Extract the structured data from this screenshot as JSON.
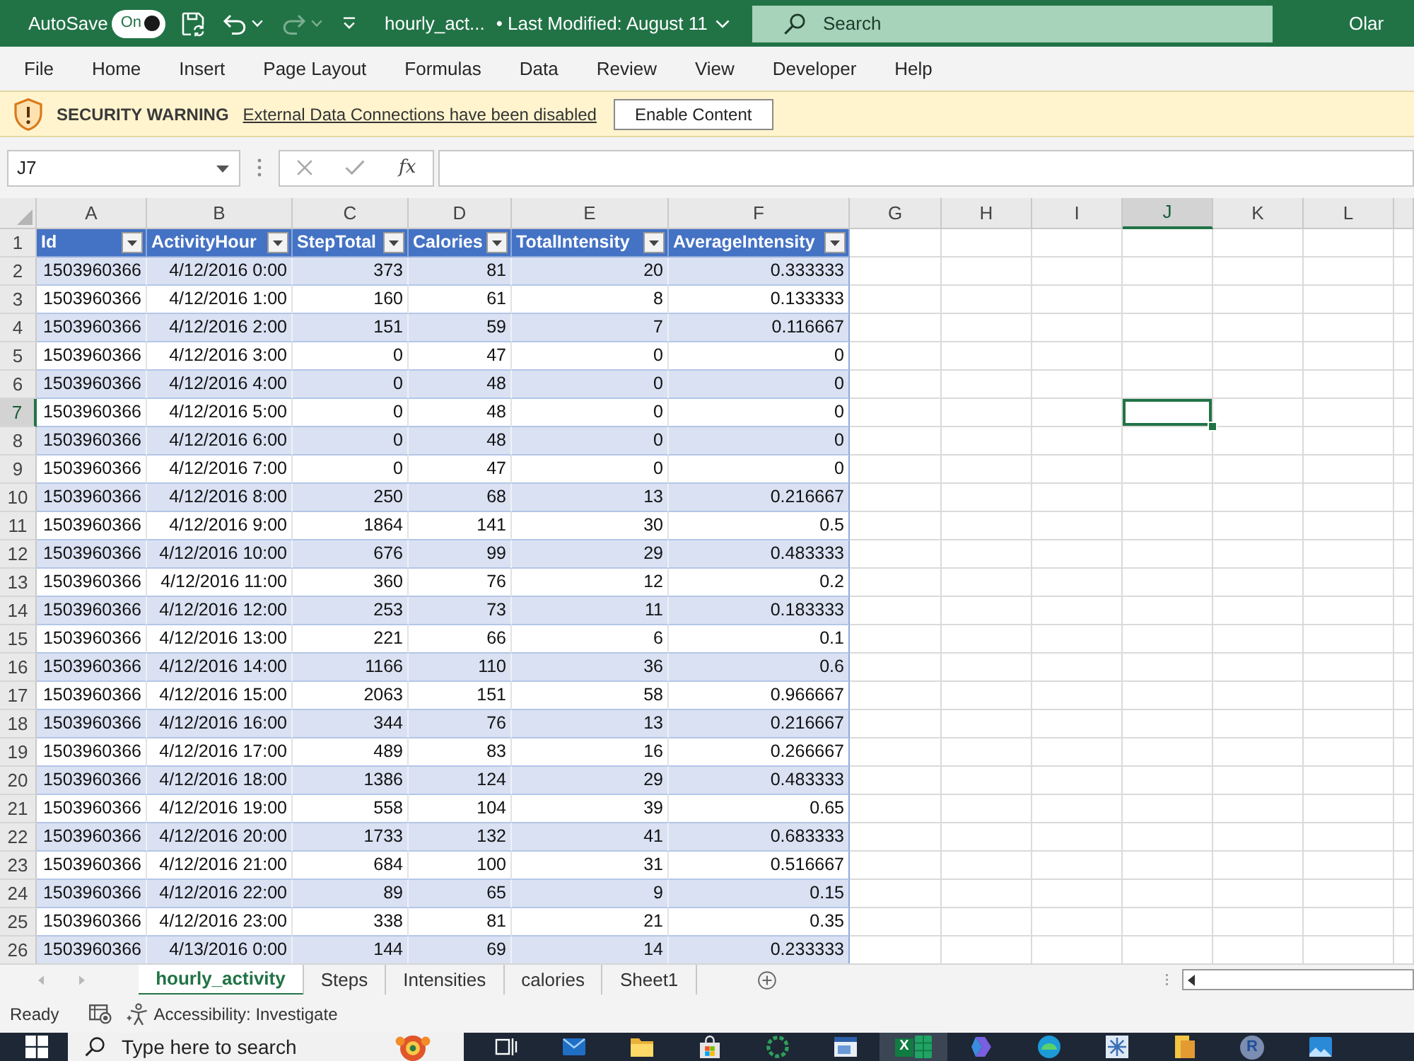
{
  "title_bar": {
    "autosave": {
      "label": "AutoSave",
      "toggle_label": "On",
      "on": true
    },
    "quick_access": [
      {
        "kind": "save",
        "disabled": false
      },
      {
        "kind": "undo",
        "disabled": false
      },
      {
        "kind": "redo",
        "disabled": true
      },
      {
        "kind": "customize",
        "disabled": false
      }
    ],
    "document": "hourly_act...",
    "modified": "• Last Modified: August 11",
    "search": {
      "placeholder": "Search"
    },
    "user": "Olar"
  },
  "menu": [
    "File",
    "Home",
    "Insert",
    "Page Layout",
    "Formulas",
    "Data",
    "Review",
    "View",
    "Developer",
    "Help"
  ],
  "security_bar": {
    "title": "SECURITY WARNING",
    "message": "External Data Connections have been disabled",
    "button": "Enable Content"
  },
  "formula_bar": {
    "name_box": "J7",
    "buttons": [
      {
        "kind": "cancel",
        "disabled": true
      },
      {
        "kind": "enter",
        "disabled": true
      }
    ],
    "function_label": "fx"
  },
  "grid": {
    "columns": [
      {
        "label": "A",
        "selected": false
      },
      {
        "label": "B",
        "selected": false
      },
      {
        "label": "C",
        "selected": false
      },
      {
        "label": "D",
        "selected": false
      },
      {
        "label": "E",
        "selected": false
      },
      {
        "label": "F",
        "selected": false
      },
      {
        "label": "G",
        "selected": false
      },
      {
        "label": "H",
        "selected": false
      },
      {
        "label": "I",
        "selected": false
      },
      {
        "label": "J",
        "selected": true
      },
      {
        "label": "K",
        "selected": false
      },
      {
        "label": "L",
        "selected": false
      }
    ],
    "table_header": {
      "row": "1",
      "autofilter": true,
      "cells": [
        "Id",
        "ActivityHour",
        "StepTotal",
        "Calories",
        "TotalIntensity",
        "AverageIntensity"
      ]
    },
    "rows": [
      {
        "row": "2",
        "selected": false,
        "cells": [
          "1503960366",
          "4/12/2016 0:00",
          "373",
          "81",
          "20",
          "0.333333"
        ]
      },
      {
        "row": "3",
        "selected": false,
        "cells": [
          "1503960366",
          "4/12/2016 1:00",
          "160",
          "61",
          "8",
          "0.133333"
        ]
      },
      {
        "row": "4",
        "selected": false,
        "cells": [
          "1503960366",
          "4/12/2016 2:00",
          "151",
          "59",
          "7",
          "0.116667"
        ]
      },
      {
        "row": "5",
        "selected": false,
        "cells": [
          "1503960366",
          "4/12/2016 3:00",
          "0",
          "47",
          "0",
          "0"
        ]
      },
      {
        "row": "6",
        "selected": false,
        "cells": [
          "1503960366",
          "4/12/2016 4:00",
          "0",
          "48",
          "0",
          "0"
        ]
      },
      {
        "row": "7",
        "selected": true,
        "cells": [
          "1503960366",
          "4/12/2016 5:00",
          "0",
          "48",
          "0",
          "0"
        ]
      },
      {
        "row": "8",
        "selected": false,
        "cells": [
          "1503960366",
          "4/12/2016 6:00",
          "0",
          "48",
          "0",
          "0"
        ]
      },
      {
        "row": "9",
        "selected": false,
        "cells": [
          "1503960366",
          "4/12/2016 7:00",
          "0",
          "47",
          "0",
          "0"
        ]
      },
      {
        "row": "10",
        "selected": false,
        "cells": [
          "1503960366",
          "4/12/2016 8:00",
          "250",
          "68",
          "13",
          "0.216667"
        ]
      },
      {
        "row": "11",
        "selected": false,
        "cells": [
          "1503960366",
          "4/12/2016 9:00",
          "1864",
          "141",
          "30",
          "0.5"
        ]
      },
      {
        "row": "12",
        "selected": false,
        "cells": [
          "1503960366",
          "4/12/2016 10:00",
          "676",
          "99",
          "29",
          "0.483333"
        ]
      },
      {
        "row": "13",
        "selected": false,
        "cells": [
          "1503960366",
          "4/12/2016 11:00",
          "360",
          "76",
          "12",
          "0.2"
        ]
      },
      {
        "row": "14",
        "selected": false,
        "cells": [
          "1503960366",
          "4/12/2016 12:00",
          "253",
          "73",
          "11",
          "0.183333"
        ]
      },
      {
        "row": "15",
        "selected": false,
        "cells": [
          "1503960366",
          "4/12/2016 13:00",
          "221",
          "66",
          "6",
          "0.1"
        ]
      },
      {
        "row": "16",
        "selected": false,
        "cells": [
          "1503960366",
          "4/12/2016 14:00",
          "1166",
          "110",
          "36",
          "0.6"
        ]
      },
      {
        "row": "17",
        "selected": false,
        "cells": [
          "1503960366",
          "4/12/2016 15:00",
          "2063",
          "151",
          "58",
          "0.966667"
        ]
      },
      {
        "row": "18",
        "selected": false,
        "cells": [
          "1503960366",
          "4/12/2016 16:00",
          "344",
          "76",
          "13",
          "0.216667"
        ]
      },
      {
        "row": "19",
        "selected": false,
        "cells": [
          "1503960366",
          "4/12/2016 17:00",
          "489",
          "83",
          "16",
          "0.266667"
        ]
      },
      {
        "row": "20",
        "selected": false,
        "cells": [
          "1503960366",
          "4/12/2016 18:00",
          "1386",
          "124",
          "29",
          "0.483333"
        ]
      },
      {
        "row": "21",
        "selected": false,
        "cells": [
          "1503960366",
          "4/12/2016 19:00",
          "558",
          "104",
          "39",
          "0.65"
        ]
      },
      {
        "row": "22",
        "selected": false,
        "cells": [
          "1503960366",
          "4/12/2016 20:00",
          "1733",
          "132",
          "41",
          "0.683333"
        ]
      },
      {
        "row": "23",
        "selected": false,
        "cells": [
          "1503960366",
          "4/12/2016 21:00",
          "684",
          "100",
          "31",
          "0.516667"
        ]
      },
      {
        "row": "24",
        "selected": false,
        "cells": [
          "1503960366",
          "4/12/2016 22:00",
          "89",
          "65",
          "9",
          "0.15"
        ]
      },
      {
        "row": "25",
        "selected": false,
        "cells": [
          "1503960366",
          "4/12/2016 23:00",
          "338",
          "81",
          "21",
          "0.35"
        ]
      },
      {
        "row": "26",
        "selected": false,
        "cells": [
          "1503960366",
          "4/13/2016 0:00",
          "144",
          "69",
          "14",
          "0.233333"
        ]
      }
    ]
  },
  "sheet_nav": [
    {
      "kind": "previous",
      "disabled": true
    },
    {
      "kind": "next",
      "disabled": true
    }
  ],
  "sheet_tabs": [
    {
      "label": "hourly_activity",
      "selected": true
    },
    {
      "label": "Steps",
      "selected": false
    },
    {
      "label": "Intensities",
      "selected": false
    },
    {
      "label": "calories",
      "selected": false
    },
    {
      "label": "Sheet1",
      "selected": false
    }
  ],
  "status_bar": {
    "status": "Ready",
    "accessibility": "Accessibility: Investigate"
  },
  "taskbar": {
    "search": {
      "placeholder": "Type here to search"
    },
    "apps": [
      {
        "kind": "task-view",
        "selected": false
      },
      {
        "kind": "mail",
        "selected": false
      },
      {
        "kind": "folder",
        "selected": false
      },
      {
        "kind": "store",
        "selected": false
      },
      {
        "kind": "ring",
        "selected": false
      },
      {
        "kind": "window",
        "selected": false
      },
      {
        "kind": "spreadsheet",
        "label": "X",
        "selected": true
      },
      {
        "kind": "copilot",
        "selected": false
      },
      {
        "kind": "browser",
        "selected": false
      },
      {
        "kind": "snowflake",
        "selected": false
      },
      {
        "kind": "document",
        "selected": false
      },
      {
        "kind": "round",
        "label": "R",
        "selected": false
      },
      {
        "kind": "photos",
        "selected": false
      }
    ]
  }
}
